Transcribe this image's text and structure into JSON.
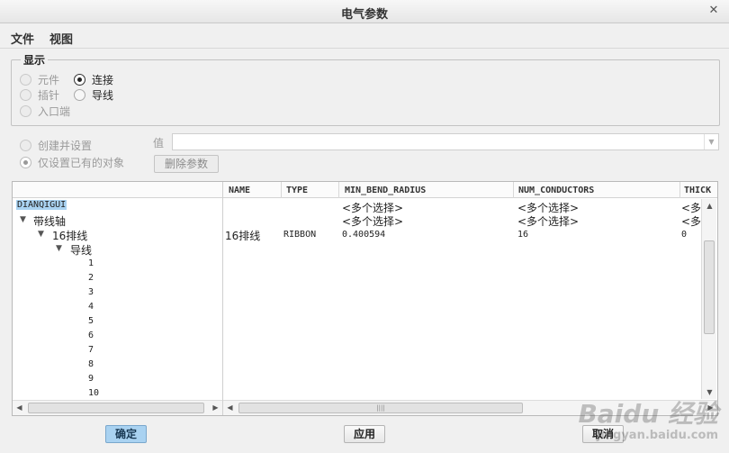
{
  "window": {
    "title": "电气参数"
  },
  "menu": [
    "文件",
    "视图"
  ],
  "display": {
    "legend": "显示",
    "options": [
      {
        "label": "元件",
        "selected": false,
        "enabled": false
      },
      {
        "label": "连接",
        "selected": true,
        "enabled": true
      },
      {
        "label": "插针",
        "selected": false,
        "enabled": false
      },
      {
        "label": "导线",
        "selected": false,
        "enabled": true
      },
      {
        "label": "入口端",
        "selected": false,
        "enabled": false
      }
    ]
  },
  "mode": {
    "options": [
      {
        "label": "创建并设置",
        "selected": false
      },
      {
        "label": "仅设置已有的对象",
        "selected": true
      }
    ],
    "value_label": "值",
    "value_input": "",
    "delete_button": "删除参数"
  },
  "table": {
    "columns": [
      "NAME",
      "TYPE",
      "MIN_BEND_RADIUS",
      "NUM_CONDUCTORS",
      "THICK"
    ],
    "tree": [
      {
        "label": "DIANQIGUI",
        "selected": true,
        "min_bend_radius": "<多个选择>",
        "num_conductors": "<多个选择>",
        "thick": "<多"
      },
      {
        "label": "带线轴",
        "min_bend_radius": "<多个选择>",
        "num_conductors": "<多个选择>",
        "thick": "<多"
      },
      {
        "label": "16排线",
        "name": "16排线",
        "type": "RIBBON",
        "min_bend_radius": "0.400594",
        "num_conductors": "16",
        "thick": "0"
      },
      {
        "label": "导线"
      },
      {
        "label": "1"
      },
      {
        "label": "2"
      },
      {
        "label": "3"
      },
      {
        "label": "4"
      },
      {
        "label": "5"
      },
      {
        "label": "6"
      },
      {
        "label": "7"
      },
      {
        "label": "8"
      },
      {
        "label": "9"
      },
      {
        "label": "10"
      }
    ]
  },
  "buttons": {
    "ok": "确定",
    "apply": "应用",
    "cancel": "取消"
  },
  "watermark": {
    "line1": "Baidu 经验",
    "line2": "jingyan.baidu.com"
  },
  "colors": {
    "selection": "#a9d2f1"
  }
}
